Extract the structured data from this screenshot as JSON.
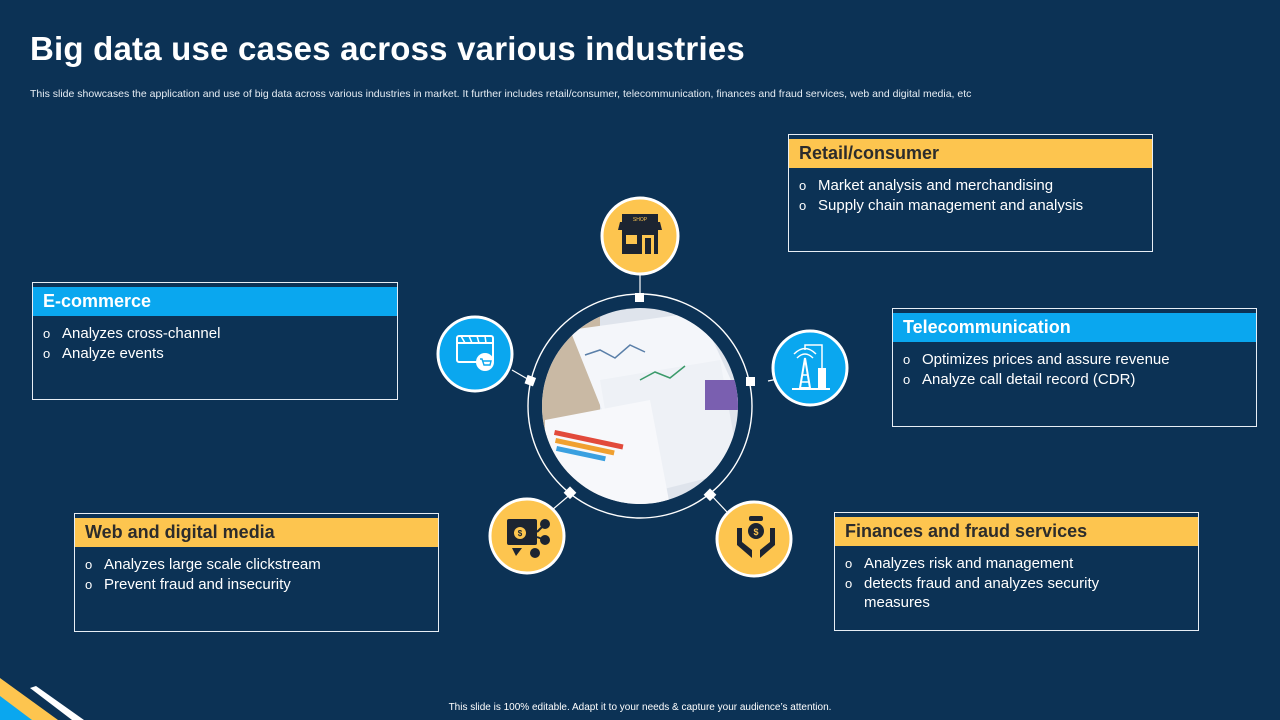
{
  "slide": {
    "title": "Big data use cases across various industries",
    "subtitle": "This slide showcases the application and use of big data across various industries in market. It further includes retail/consumer, telecommunication, finances and fraud services, web and digital media, etc",
    "footer": "This slide is 100% editable. Adapt it to your needs & capture your audience’s attention."
  },
  "colors": {
    "background": "#0c3255",
    "accent_yellow": "#fdc54f",
    "accent_blue": "#0aa7ef"
  },
  "cards": {
    "retail": {
      "title": "Retail/consumer",
      "items": [
        "Market analysis and merchandising",
        "Supply chain management and analysis"
      ],
      "icon": "shop-icon"
    },
    "ecommerce": {
      "title": "E-commerce",
      "items": [
        "Analyzes cross-channel",
        "Analyze events"
      ],
      "icon": "online-store-icon"
    },
    "telecom": {
      "title": "Telecommunication",
      "items": [
        "Optimizes prices and assure revenue",
        "Analyze call detail record (CDR)"
      ],
      "icon": "transmission-tower-icon"
    },
    "web": {
      "title": "Web and digital media",
      "items": [
        "Analyzes large scale clickstream",
        "Prevent fraud and insecurity"
      ],
      "icon": "digital-media-icon"
    },
    "finance": {
      "title": "Finances and fraud services",
      "items": [
        "Analyzes risk and management",
        " detects fraud and analyzes security measures"
      ],
      "icon": "money-hands-icon"
    }
  },
  "icon_labels": {
    "shop_sign": "SHOP"
  },
  "bullet_char": "o"
}
